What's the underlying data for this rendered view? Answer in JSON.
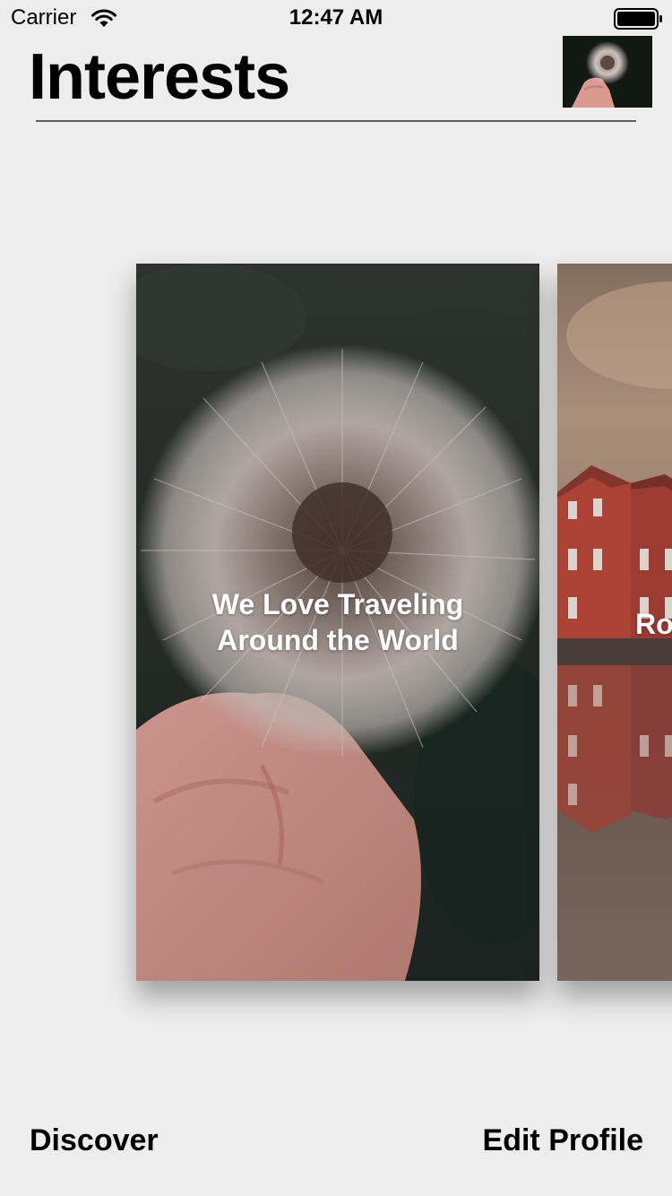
{
  "status_bar": {
    "carrier": "Carrier",
    "time": "12:47 AM",
    "wifi_icon": "wifi-icon",
    "battery_icon": "battery-icon"
  },
  "header": {
    "title": "Interests",
    "avatar_icon": "dandelion-avatar"
  },
  "cards": [
    {
      "title": "We Love Traveling Around the World",
      "image": "dandelion-in-hand"
    },
    {
      "title": "Ro",
      "image": "red-houses-reflection"
    }
  ],
  "nav": {
    "discover_label": "Discover",
    "edit_profile_label": "Edit Profile"
  },
  "colors": {
    "background": "#ededed",
    "text": "#000000",
    "divider": "#606060"
  }
}
